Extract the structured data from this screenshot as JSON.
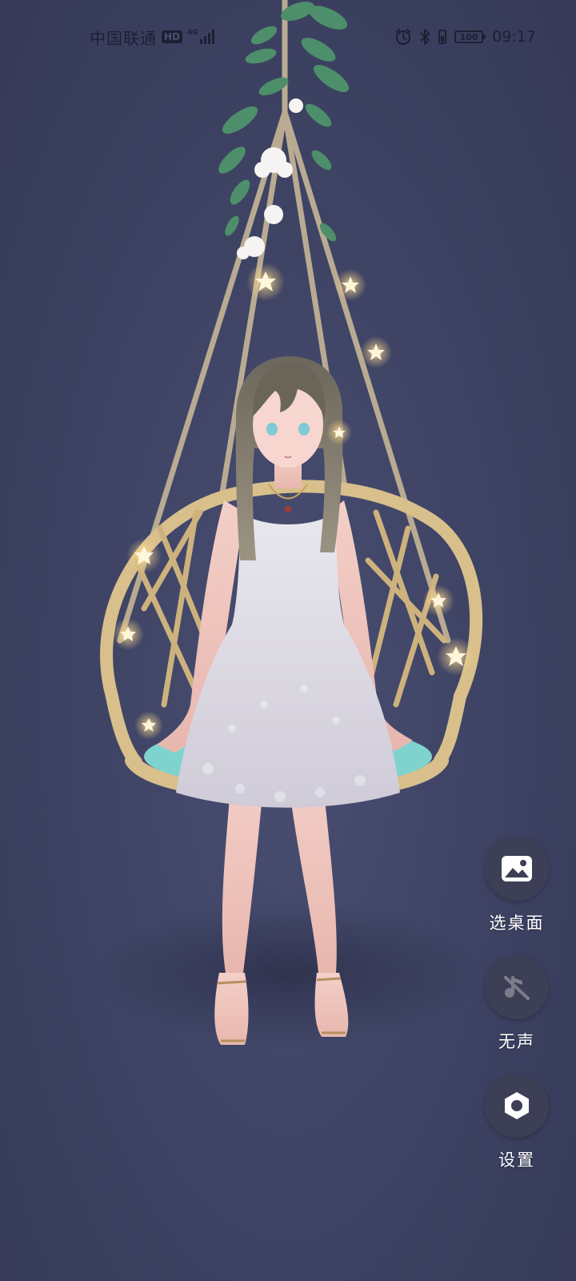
{
  "status_bar": {
    "carrier": "中国联通",
    "hd": "HD",
    "network": "4G",
    "battery": "100",
    "time": "09:17"
  },
  "icons": {
    "alarm": "alarm-clock-icon",
    "bluetooth": "bluetooth-icon",
    "vibrate": "vibrate-battery-icon"
  },
  "actions": [
    {
      "label": "选桌面",
      "icon": "image-icon"
    },
    {
      "label": "无声",
      "icon": "music-off-icon"
    },
    {
      "label": "设置",
      "icon": "settings-icon"
    }
  ],
  "colors": {
    "background": "#43476a",
    "button_bg": "#3c3f55",
    "seat_cushion": "#7fd3cf",
    "rattan": "#d8bf8c"
  }
}
